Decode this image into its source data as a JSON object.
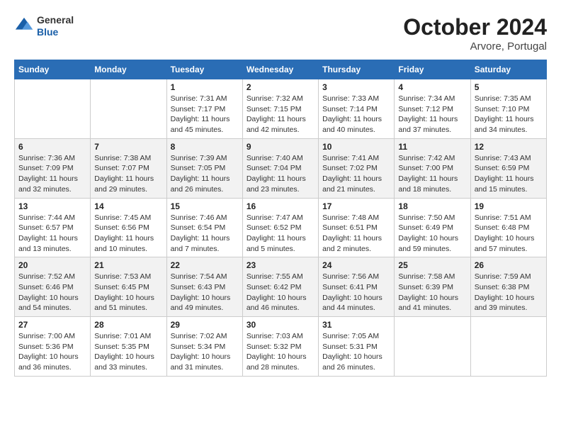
{
  "header": {
    "logo": {
      "general": "General",
      "blue": "Blue"
    },
    "month": "October 2024",
    "location": "Arvore, Portugal"
  },
  "columns": [
    "Sunday",
    "Monday",
    "Tuesday",
    "Wednesday",
    "Thursday",
    "Friday",
    "Saturday"
  ],
  "weeks": [
    [
      {
        "day": "",
        "info": ""
      },
      {
        "day": "",
        "info": ""
      },
      {
        "day": "1",
        "info": "Sunrise: 7:31 AM\nSunset: 7:17 PM\nDaylight: 11 hours and 45 minutes."
      },
      {
        "day": "2",
        "info": "Sunrise: 7:32 AM\nSunset: 7:15 PM\nDaylight: 11 hours and 42 minutes."
      },
      {
        "day": "3",
        "info": "Sunrise: 7:33 AM\nSunset: 7:14 PM\nDaylight: 11 hours and 40 minutes."
      },
      {
        "day": "4",
        "info": "Sunrise: 7:34 AM\nSunset: 7:12 PM\nDaylight: 11 hours and 37 minutes."
      },
      {
        "day": "5",
        "info": "Sunrise: 7:35 AM\nSunset: 7:10 PM\nDaylight: 11 hours and 34 minutes."
      }
    ],
    [
      {
        "day": "6",
        "info": "Sunrise: 7:36 AM\nSunset: 7:09 PM\nDaylight: 11 hours and 32 minutes."
      },
      {
        "day": "7",
        "info": "Sunrise: 7:38 AM\nSunset: 7:07 PM\nDaylight: 11 hours and 29 minutes."
      },
      {
        "day": "8",
        "info": "Sunrise: 7:39 AM\nSunset: 7:05 PM\nDaylight: 11 hours and 26 minutes."
      },
      {
        "day": "9",
        "info": "Sunrise: 7:40 AM\nSunset: 7:04 PM\nDaylight: 11 hours and 23 minutes."
      },
      {
        "day": "10",
        "info": "Sunrise: 7:41 AM\nSunset: 7:02 PM\nDaylight: 11 hours and 21 minutes."
      },
      {
        "day": "11",
        "info": "Sunrise: 7:42 AM\nSunset: 7:00 PM\nDaylight: 11 hours and 18 minutes."
      },
      {
        "day": "12",
        "info": "Sunrise: 7:43 AM\nSunset: 6:59 PM\nDaylight: 11 hours and 15 minutes."
      }
    ],
    [
      {
        "day": "13",
        "info": "Sunrise: 7:44 AM\nSunset: 6:57 PM\nDaylight: 11 hours and 13 minutes."
      },
      {
        "day": "14",
        "info": "Sunrise: 7:45 AM\nSunset: 6:56 PM\nDaylight: 11 hours and 10 minutes."
      },
      {
        "day": "15",
        "info": "Sunrise: 7:46 AM\nSunset: 6:54 PM\nDaylight: 11 hours and 7 minutes."
      },
      {
        "day": "16",
        "info": "Sunrise: 7:47 AM\nSunset: 6:52 PM\nDaylight: 11 hours and 5 minutes."
      },
      {
        "day": "17",
        "info": "Sunrise: 7:48 AM\nSunset: 6:51 PM\nDaylight: 11 hours and 2 minutes."
      },
      {
        "day": "18",
        "info": "Sunrise: 7:50 AM\nSunset: 6:49 PM\nDaylight: 10 hours and 59 minutes."
      },
      {
        "day": "19",
        "info": "Sunrise: 7:51 AM\nSunset: 6:48 PM\nDaylight: 10 hours and 57 minutes."
      }
    ],
    [
      {
        "day": "20",
        "info": "Sunrise: 7:52 AM\nSunset: 6:46 PM\nDaylight: 10 hours and 54 minutes."
      },
      {
        "day": "21",
        "info": "Sunrise: 7:53 AM\nSunset: 6:45 PM\nDaylight: 10 hours and 51 minutes."
      },
      {
        "day": "22",
        "info": "Sunrise: 7:54 AM\nSunset: 6:43 PM\nDaylight: 10 hours and 49 minutes."
      },
      {
        "day": "23",
        "info": "Sunrise: 7:55 AM\nSunset: 6:42 PM\nDaylight: 10 hours and 46 minutes."
      },
      {
        "day": "24",
        "info": "Sunrise: 7:56 AM\nSunset: 6:41 PM\nDaylight: 10 hours and 44 minutes."
      },
      {
        "day": "25",
        "info": "Sunrise: 7:58 AM\nSunset: 6:39 PM\nDaylight: 10 hours and 41 minutes."
      },
      {
        "day": "26",
        "info": "Sunrise: 7:59 AM\nSunset: 6:38 PM\nDaylight: 10 hours and 39 minutes."
      }
    ],
    [
      {
        "day": "27",
        "info": "Sunrise: 7:00 AM\nSunset: 5:36 PM\nDaylight: 10 hours and 36 minutes."
      },
      {
        "day": "28",
        "info": "Sunrise: 7:01 AM\nSunset: 5:35 PM\nDaylight: 10 hours and 33 minutes."
      },
      {
        "day": "29",
        "info": "Sunrise: 7:02 AM\nSunset: 5:34 PM\nDaylight: 10 hours and 31 minutes."
      },
      {
        "day": "30",
        "info": "Sunrise: 7:03 AM\nSunset: 5:32 PM\nDaylight: 10 hours and 28 minutes."
      },
      {
        "day": "31",
        "info": "Sunrise: 7:05 AM\nSunset: 5:31 PM\nDaylight: 10 hours and 26 minutes."
      },
      {
        "day": "",
        "info": ""
      },
      {
        "day": "",
        "info": ""
      }
    ]
  ]
}
